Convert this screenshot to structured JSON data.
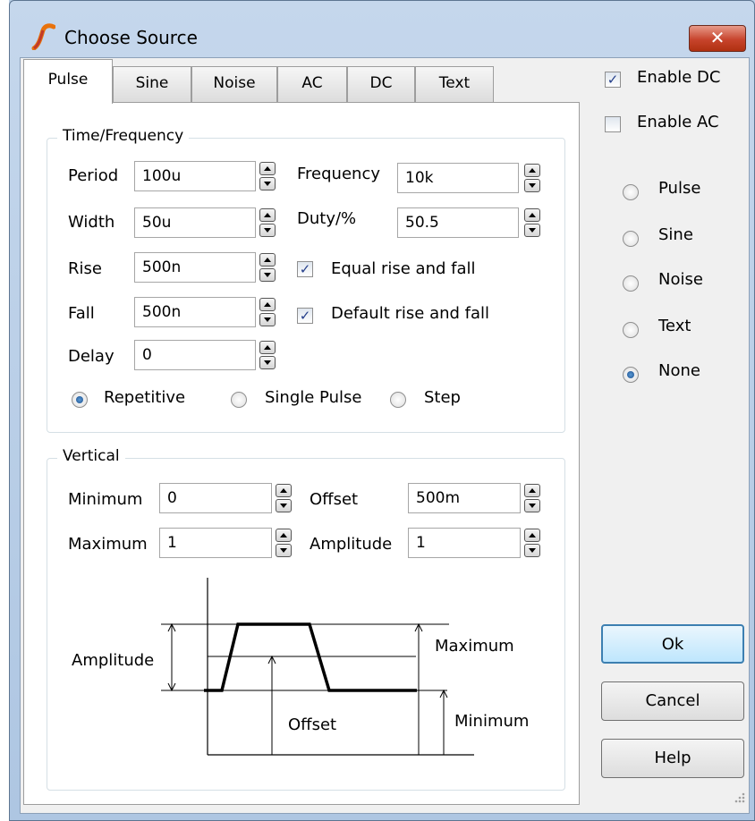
{
  "window": {
    "title": "Choose Source",
    "close_symbol": "✕"
  },
  "tabs": [
    "Pulse",
    "Sine",
    "Noise",
    "AC",
    "DC",
    "Text"
  ],
  "time_group": {
    "title": "Time/Frequency",
    "period": {
      "label": "Period",
      "value": "100u"
    },
    "width": {
      "label": "Width",
      "value": "50u"
    },
    "rise": {
      "label": "Rise",
      "value": "500n"
    },
    "fall": {
      "label": "Fall",
      "value": "500n"
    },
    "delay": {
      "label": "Delay",
      "value": "0"
    },
    "frequency": {
      "label": "Frequency",
      "value": "10k"
    },
    "duty": {
      "label": "Duty/%",
      "value": "50.5"
    },
    "equal_rise_fall": {
      "label": "Equal rise and fall",
      "checked": true
    },
    "default_rise_fall": {
      "label": "Default rise and fall",
      "checked": true
    },
    "modes": [
      {
        "label": "Repetitive",
        "selected": true
      },
      {
        "label": "Single Pulse",
        "selected": false
      },
      {
        "label": "Step",
        "selected": false
      }
    ]
  },
  "vertical_group": {
    "title": "Vertical",
    "minimum": {
      "label": "Minimum",
      "value": "0"
    },
    "maximum": {
      "label": "Maximum",
      "value": "1"
    },
    "offset": {
      "label": "Offset",
      "value": "500m"
    },
    "amplitude": {
      "label": "Amplitude",
      "value": "1"
    }
  },
  "diagram": {
    "amplitude": "Amplitude",
    "maximum": "Maximum",
    "offset": "Offset",
    "minimum": "Minimum"
  },
  "right_panel": {
    "enable_dc": {
      "label": "Enable DC",
      "checked": true
    },
    "enable_ac": {
      "label": "Enable AC",
      "checked": false
    },
    "sources": [
      {
        "label": "Pulse",
        "selected": false
      },
      {
        "label": "Sine",
        "selected": false
      },
      {
        "label": "Noise",
        "selected": false
      },
      {
        "label": "Text",
        "selected": false
      },
      {
        "label": "None",
        "selected": true
      }
    ],
    "ok": "Ok",
    "cancel": "Cancel",
    "help": "Help"
  },
  "check_mark": "✓"
}
